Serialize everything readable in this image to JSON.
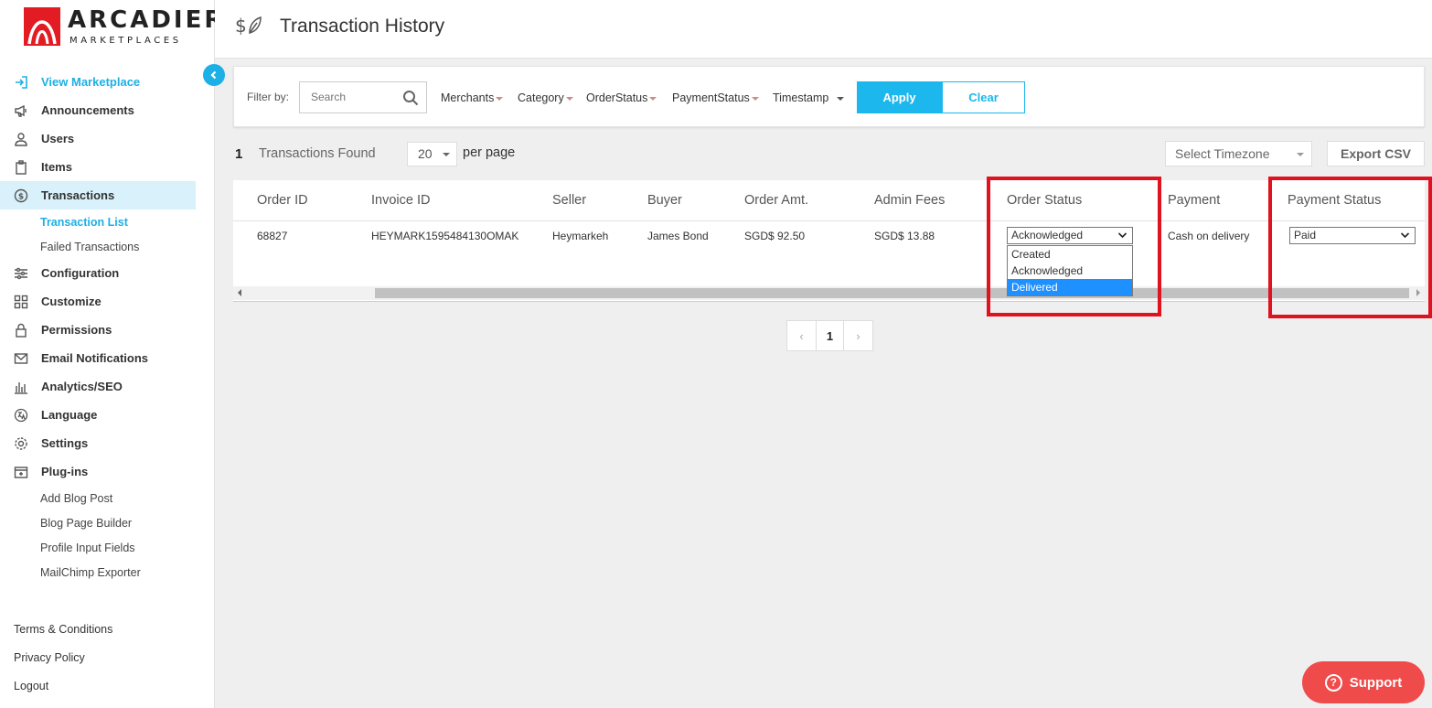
{
  "brand": {
    "name": "ARCADIER",
    "tagline": "MARKETPLACES",
    "accent": "#1cb0e6",
    "logo_red": "#e31b23"
  },
  "header": {
    "icon": "dollar-leaf-icon",
    "title": "Transaction History"
  },
  "sidebar": {
    "collapse_icon": "chevron-left-icon",
    "items": [
      {
        "label": "View Marketplace",
        "icon": "enter-icon"
      },
      {
        "label": "Announcements",
        "icon": "megaphone-icon"
      },
      {
        "label": "Users",
        "icon": "user-icon"
      },
      {
        "label": "Items",
        "icon": "clipboard-icon"
      },
      {
        "label": "Transactions",
        "icon": "dollar-circle-icon"
      },
      {
        "label": "Configuration",
        "icon": "sliders-icon"
      },
      {
        "label": "Customize",
        "icon": "grid-icon"
      },
      {
        "label": "Permissions",
        "icon": "lock-icon"
      },
      {
        "label": "Email Notifications",
        "icon": "envelope-icon"
      },
      {
        "label": "Analytics/SEO",
        "icon": "bar-chart-icon"
      },
      {
        "label": "Language",
        "icon": "translate-icon"
      },
      {
        "label": "Settings",
        "icon": "gear-icon"
      },
      {
        "label": "Plug-ins",
        "icon": "plugin-box-icon"
      }
    ],
    "transactions_sub": [
      "Transaction List",
      "Failed Transactions"
    ],
    "plugins_sub": [
      "Add Blog Post",
      "Blog Page Builder",
      "Profile Input Fields",
      "MailChimp Exporter"
    ],
    "bottom": [
      "Terms & Conditions",
      "Privacy Policy",
      "Logout"
    ]
  },
  "filter": {
    "label": "Filter by:",
    "search_placeholder": "Search",
    "dropdowns": [
      "Merchants",
      "Category",
      "OrderStatus",
      "PaymentStatus",
      "Timestamp"
    ],
    "apply": "Apply",
    "clear": "Clear"
  },
  "results": {
    "count": "1",
    "count_label": "Transactions Found",
    "per_page_value": "20",
    "per_page_label": "per page",
    "timezone_placeholder": "Select Timezone",
    "export": "Export CSV"
  },
  "table": {
    "columns": [
      "Order ID",
      "Invoice ID",
      "Seller",
      "Buyer",
      "Order Amt.",
      "Admin Fees",
      "Order Status",
      "Payment",
      "Payment Status"
    ],
    "rows": [
      {
        "order_id": "68827",
        "invoice_id": "HEYMARK1595484130OMAK",
        "seller": "Heymarkeh",
        "buyer": "James Bond",
        "order_amt": "SGD$ 92.50",
        "admin_fees": "SGD$ 13.88",
        "order_status": "Acknowledged",
        "payment": "Cash on delivery",
        "payment_status": "Paid"
      }
    ],
    "order_status_options": [
      "Created",
      "Acknowledged",
      "Delivered"
    ],
    "order_status_highlighted": "Delivered"
  },
  "pagination": {
    "prev": "‹",
    "current": "1",
    "next": "›"
  },
  "support": {
    "label": "Support",
    "icon": "question-circle-icon",
    "color": "#ef4b4b"
  },
  "highlight_color": "#e0121f"
}
